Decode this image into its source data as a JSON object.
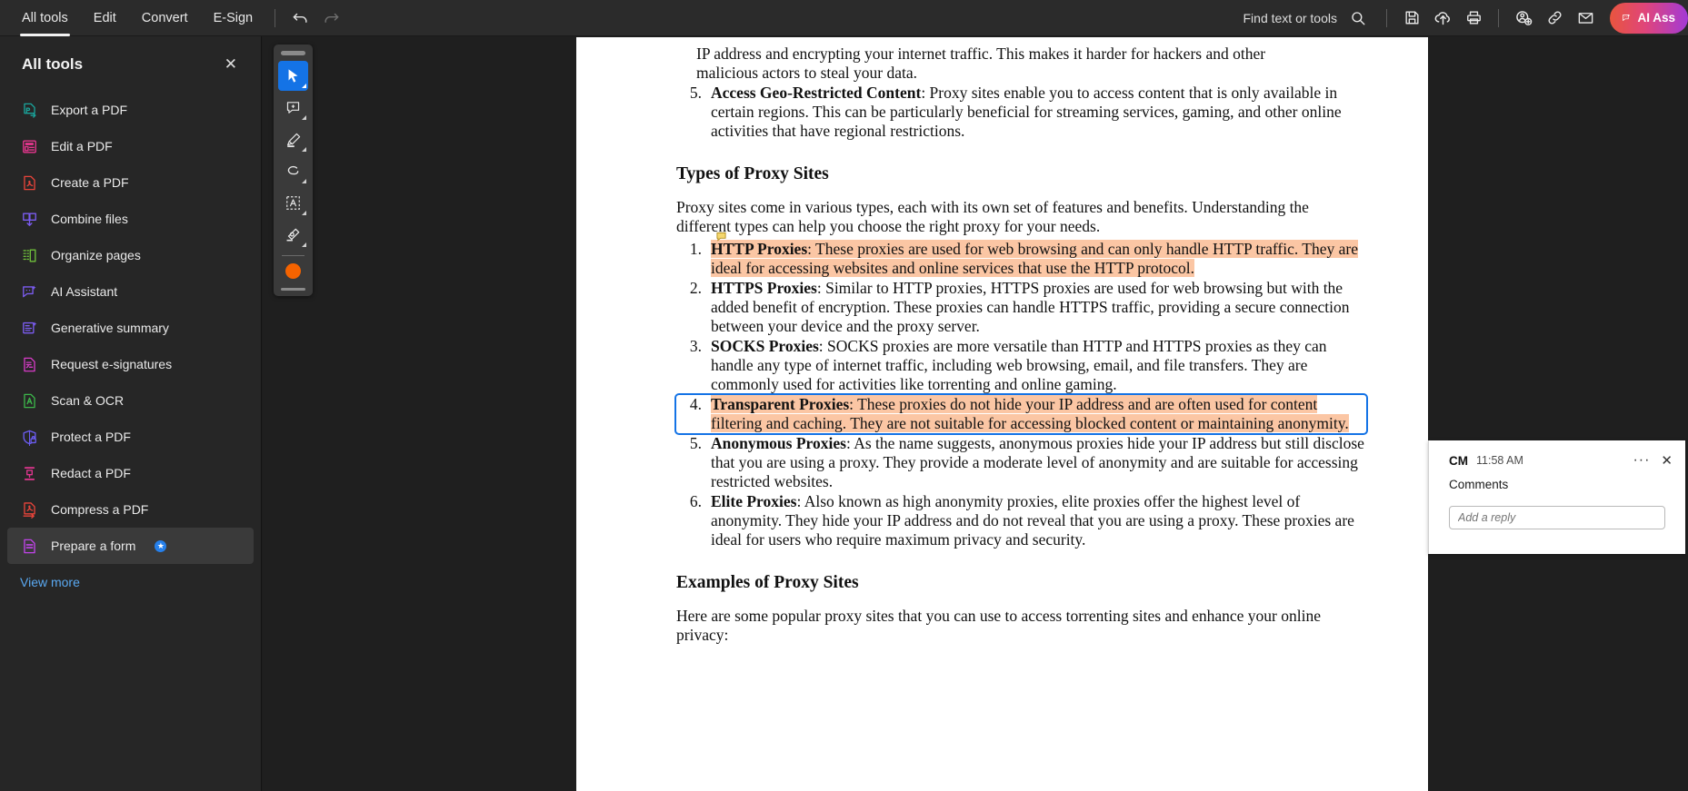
{
  "topbar": {
    "menus": [
      {
        "label": "All tools",
        "active": true
      },
      {
        "label": "Edit",
        "active": false
      },
      {
        "label": "Convert",
        "active": false
      },
      {
        "label": "E-Sign",
        "active": false
      }
    ],
    "undo_label": "Undo",
    "redo_label": "Redo",
    "find_label": "Find text or tools",
    "icons": [
      "search-icon",
      "save-icon",
      "cloud-upload-icon",
      "print-icon",
      "add-person-icon",
      "link-icon",
      "email-icon"
    ],
    "ai_button_label": "AI Ass",
    "ai_gradient_from": "#e8553e",
    "ai_gradient_to": "#a33ad6"
  },
  "sidebar": {
    "title": "All tools",
    "close_label": "✕",
    "items": [
      {
        "label": "Export a PDF",
        "icon": "export-pdf-icon",
        "color": "#1aa39a",
        "selected": false
      },
      {
        "label": "Edit a PDF",
        "icon": "edit-pdf-icon",
        "color": "#e8368f",
        "selected": false
      },
      {
        "label": "Create a PDF",
        "icon": "create-pdf-icon",
        "color": "#e8443a",
        "selected": false
      },
      {
        "label": "Combine files",
        "icon": "combine-files-icon",
        "color": "#7b5cf0",
        "selected": false
      },
      {
        "label": "Organize pages",
        "icon": "organize-pages-icon",
        "color": "#6fbf3b",
        "selected": false
      },
      {
        "label": "AI Assistant",
        "icon": "ai-assistant-icon",
        "color": "#7b5cf0",
        "selected": false
      },
      {
        "label": "Generative summary",
        "icon": "generative-summary-icon",
        "color": "#7b5cf0",
        "selected": false
      },
      {
        "label": "Request e-signatures",
        "icon": "request-esignatures-icon",
        "color": "#d43bc4",
        "selected": false
      },
      {
        "label": "Scan & OCR",
        "icon": "scan-ocr-icon",
        "color": "#3cb54a",
        "selected": false
      },
      {
        "label": "Protect a PDF",
        "icon": "protect-pdf-icon",
        "color": "#6b5cf0",
        "selected": false
      },
      {
        "label": "Redact a PDF",
        "icon": "redact-pdf-icon",
        "color": "#e0368f",
        "selected": false
      },
      {
        "label": "Compress a PDF",
        "icon": "compress-pdf-icon",
        "color": "#e8443a",
        "selected": false
      },
      {
        "label": "Prepare a form",
        "icon": "prepare-form-icon",
        "color": "#c044e8",
        "selected": true,
        "badge": "★"
      }
    ],
    "view_more": "View more"
  },
  "palette": {
    "tools": [
      {
        "name": "select-cursor-tool",
        "active": true
      },
      {
        "name": "add-comment-tool",
        "active": false
      },
      {
        "name": "highlight-tool",
        "active": false
      },
      {
        "name": "draw-tool",
        "active": false
      },
      {
        "name": "text-select-tool",
        "active": false
      },
      {
        "name": "erase-tool",
        "active": false
      }
    ],
    "color_swatch": "#f56300"
  },
  "document": {
    "intro_cont_1": "IP address and encrypting your internet traffic. This makes it harder for hackers and other",
    "intro_cont_2": "malicious actors to steal your data.",
    "item5_top_num": "5.",
    "item5_top_bold": "Access Geo-Restricted Content",
    "item5_top_rest": ": Proxy sites enable you to access content that is only available in certain regions. This can be particularly beneficial for streaming services, gaming, and other online activities that have regional restrictions.",
    "heading_types": "Types of Proxy Sites",
    "para_types": "Proxy sites come in various types, each with its own set of features and benefits. Understanding the different types can help you choose the right proxy for your needs.",
    "list": [
      {
        "num": "1.",
        "bold": "HTTP Proxies",
        "rest": ": These proxies are used for web browsing and can only handle HTTP traffic. They are ideal for accessing websites and online services that use the HTTP protocol.",
        "highlighted": true,
        "selected": false,
        "has_comment_flag": true
      },
      {
        "num": "2.",
        "bold": "HTTPS Proxies",
        "rest": ": Similar to HTTP proxies, HTTPS proxies are used for web browsing but with the added benefit of encryption. These proxies can handle HTTPS traffic, providing a secure connection between your device and the proxy server.",
        "highlighted": false,
        "selected": false,
        "has_comment_flag": false
      },
      {
        "num": "3.",
        "bold": "SOCKS Proxies",
        "rest": ": SOCKS proxies are more versatile than HTTP and HTTPS proxies as they can handle any type of internet traffic, including web browsing, email, and file transfers. They are commonly used for activities like torrenting and online gaming.",
        "highlighted": false,
        "selected": false,
        "has_comment_flag": false
      },
      {
        "num": "4.",
        "bold": "Transparent Proxies",
        "rest": ": These proxies do not hide your IP address and are often used for content filtering and caching. They are not suitable for accessing blocked content or maintaining anonymity.",
        "highlighted": true,
        "selected": true,
        "has_comment_flag": false
      },
      {
        "num": "5.",
        "bold": "Anonymous Proxies",
        "rest": ": As the name suggests, anonymous proxies hide your IP address but still disclose that you are using a proxy. They provide a moderate level of anonymity and are suitable for accessing restricted websites.",
        "highlighted": false,
        "selected": false,
        "has_comment_flag": false
      },
      {
        "num": "6.",
        "bold": "Elite Proxies",
        "rest": ": Also known as high anonymity proxies, elite proxies offer the highest level of anonymity. They hide your IP address and do not reveal that you are using a proxy. These proxies are ideal for users who require maximum privacy and security.",
        "highlighted": false,
        "selected": false,
        "has_comment_flag": false
      }
    ],
    "heading_examples": "Examples of Proxy Sites",
    "para_examples": "Here are some popular proxy sites that you can use to access torrenting sites and enhance your online privacy:",
    "highlight_color": "#fbc6a4",
    "selection_color": "#1473e6"
  },
  "comment_popup": {
    "initials": "CM",
    "time": "11:58 AM",
    "body": "Comments",
    "reply_placeholder": "Add a reply",
    "more_label": "···",
    "close_label": "✕"
  }
}
